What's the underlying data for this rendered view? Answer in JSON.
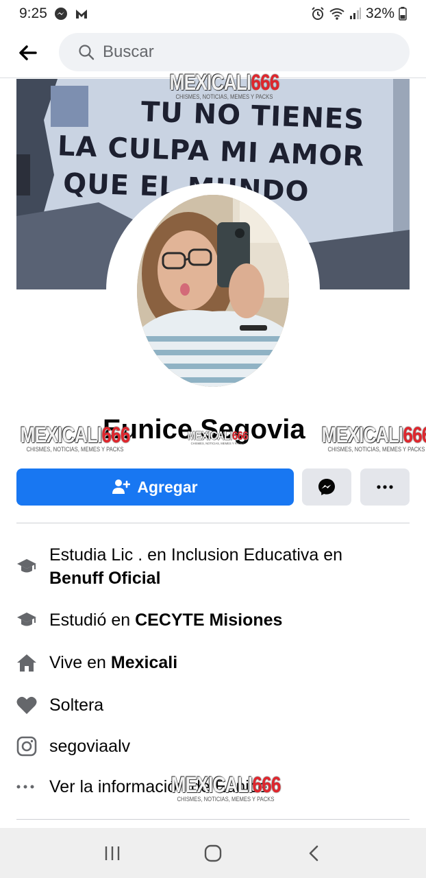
{
  "status_bar": {
    "time": "9:25",
    "battery": "32%",
    "left_icons": [
      "messenger-icon",
      "m-app-icon"
    ],
    "right_icons": [
      "alarm-icon",
      "wifi-icon",
      "signal-icon",
      "battery-icon"
    ]
  },
  "search": {
    "placeholder": "Buscar"
  },
  "cover": {
    "graffiti_lines": [
      "TU NO TIENES",
      "LA CULPA MI AMOR",
      "QUE EL MUNDO"
    ]
  },
  "watermark": {
    "part_a": "MEXICALI",
    "part_b": "666",
    "tagline": "CHISMES, NOTICIAS, MEMES Y PACKS"
  },
  "profile": {
    "name": "Eunice Segovia"
  },
  "actions": {
    "add_label": "Agregar"
  },
  "details": {
    "studies_prefix": "Estudia Lic . en Inclusion Educativa en",
    "studies_place": "Benuff Oficial",
    "studied_prefix": "Estudió en",
    "studied_place": "CECYTE Misiones",
    "lives_prefix": "Vive en",
    "lives_place": "Mexicali",
    "relationship": "Soltera",
    "instagram": "segoviaalv",
    "more_info": "Ver la información de Eunice"
  },
  "colors": {
    "primary": "#1877f2",
    "button_gray": "#e4e6eb",
    "icon_gray": "#65676b",
    "watermark_red": "#e0262d"
  }
}
